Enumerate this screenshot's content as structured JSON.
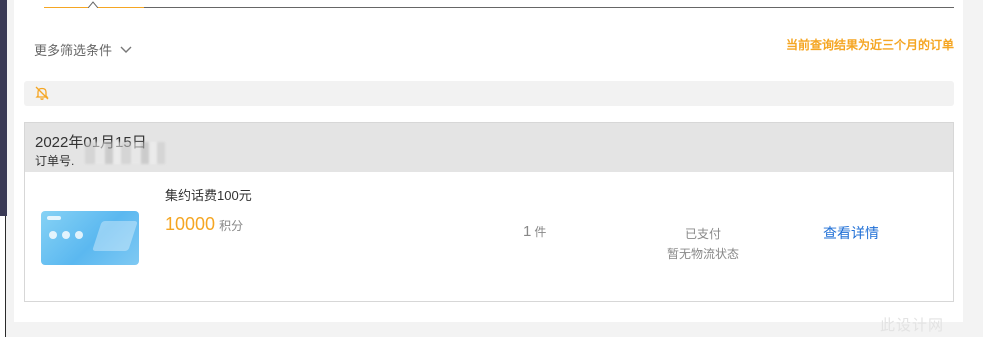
{
  "filters": {
    "more_label": "更多筛选条件",
    "notice": "当前查询结果为近三个月的订单"
  },
  "order": {
    "date": "2022年01月15日",
    "order_no_label": "订单号.",
    "product": {
      "name": "集约话费100元",
      "points_value": "10000",
      "points_unit": "积分"
    },
    "quantity": "1",
    "quantity_unit": "件",
    "payment_status": "已支付",
    "logistics_status": "暂无物流状态",
    "detail_link": "查看详情"
  },
  "watermark": "此设计网",
  "colors": {
    "accent_orange": "#f5a623",
    "link_blue": "#1f6fd6",
    "header_gray": "#e4e4e4",
    "page_bg": "#f3f3f3"
  },
  "icons": {
    "filter_toggle": "chevron-down-icon",
    "tip": "bell-off-icon",
    "tab_marker": "caret-up-icon"
  }
}
